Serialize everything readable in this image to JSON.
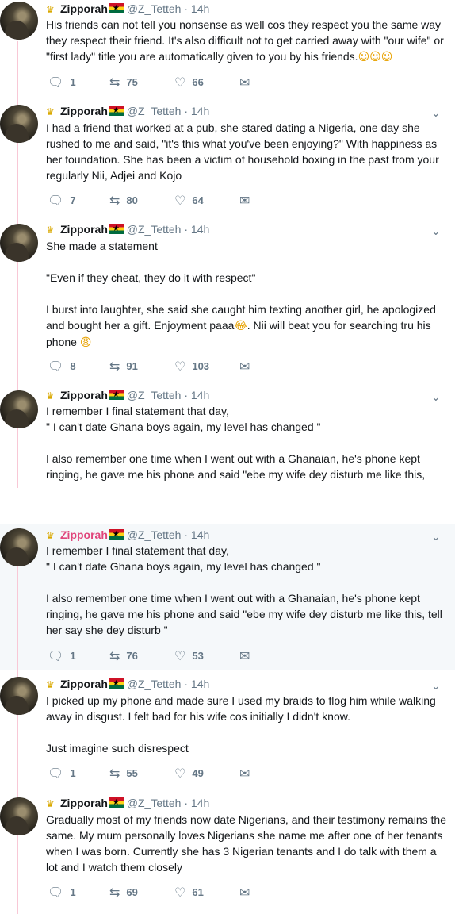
{
  "author": {
    "crown_icon": "crown-emoji",
    "flag_icon": "ghana-flag-emoji",
    "name": "Zipporah",
    "handle": "@Z_Tetteh",
    "dot": "·",
    "time": "14h"
  },
  "icons": {
    "reply": "reply-icon",
    "retweet": "retweet-icon",
    "like": "heart-icon",
    "dm": "envelope-icon",
    "more": "chevron-down-icon"
  },
  "colors": {
    "thread": "#f8c8d6",
    "muted": "#657786",
    "highlight": "#f5f8fa",
    "link": "#e0457b"
  },
  "tweets": [
    {
      "text": "His friends can not tell you nonsense as well cos they respect you the same way they respect their friend. It's also difficult not to get carried away with \"our wife\" or \"first lady\" title you are automatically given to you by his friends.",
      "emoji": "☺☺☺",
      "replies": "1",
      "retweets": "75",
      "likes": "66"
    },
    {
      "text": "I had a friend that worked at a pub,  she stared dating a Nigeria, one day she rushed to me and said, \"it's this what you've been enjoying?\" With happiness as her foundation. She has been a victim of household boxing in the past from your regularly Nii, Adjei and Kojo",
      "replies": "7",
      "retweets": "80",
      "likes": "64"
    },
    {
      "text": "She made a statement\n\n\"Even if they cheat, they do it with respect\"\n\nI burst into laughter, she said she caught him texting another girl, he apologized and bought her a gift. Enjoyment paaa",
      "emoji_a": "😂",
      "text_b": ". Nii will beat you for searching tru his phone ",
      "emoji_b": "😩",
      "replies": "8",
      "retweets": "91",
      "likes": "103"
    },
    {
      "text": "I remember I final statement that day,\n\" I can't date Ghana boys again, my level has changed \"\n\nI also remember one time when I went out with a Ghanaian, he's phone kept ringing,  he gave me his phone and said \"ebe my wife dey disturb me like this,"
    },
    {
      "text": "I remember I final statement that day,\n\" I can't date Ghana boys again, my level has changed \"\n\nI also remember one time when I went out with a Ghanaian, he's phone kept ringing,  he gave me his phone and said \"ebe my wife dey disturb me like this, tell her say she dey  disturb \"",
      "replies": "1",
      "retweets": "76",
      "likes": "53"
    },
    {
      "text": "I picked  up my phone and  made sure I used my braids to flog him while walking away in disgust.  I felt bad for his wife cos initially  I didn't know.\n\nJust imagine such disrespect",
      "replies": "1",
      "retweets": "55",
      "likes": "49"
    },
    {
      "text": "Gradually most of my friends now  date Nigerians, and their testimony  remains the same. My mum personally loves Nigerians she name me after one of her tenants  when I was born. Currently  she has 3 Nigerian  tenants  and I do talk with them a lot and I watch them closely",
      "replies": "1",
      "retweets": "69",
      "likes": "61"
    }
  ]
}
